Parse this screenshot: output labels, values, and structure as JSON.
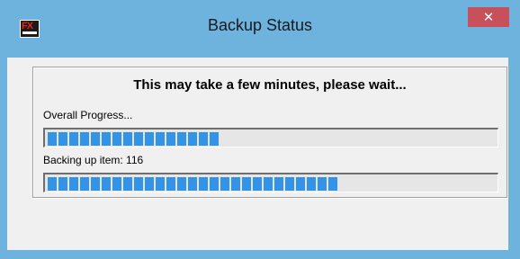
{
  "window": {
    "title": "Backup Status",
    "app_icon_text": "FX",
    "close_glyph": "✕"
  },
  "dialog": {
    "heading": "This may take a few minutes, please wait...",
    "overall_label": "Overall Progress...",
    "overall_progress": 0.38,
    "item_label": "Backing up item: 116",
    "item_progress": 0.66
  },
  "colors": {
    "title_bar": "#6db3de",
    "close_button": "#c7505a",
    "progress_fill": "#3393e8"
  }
}
